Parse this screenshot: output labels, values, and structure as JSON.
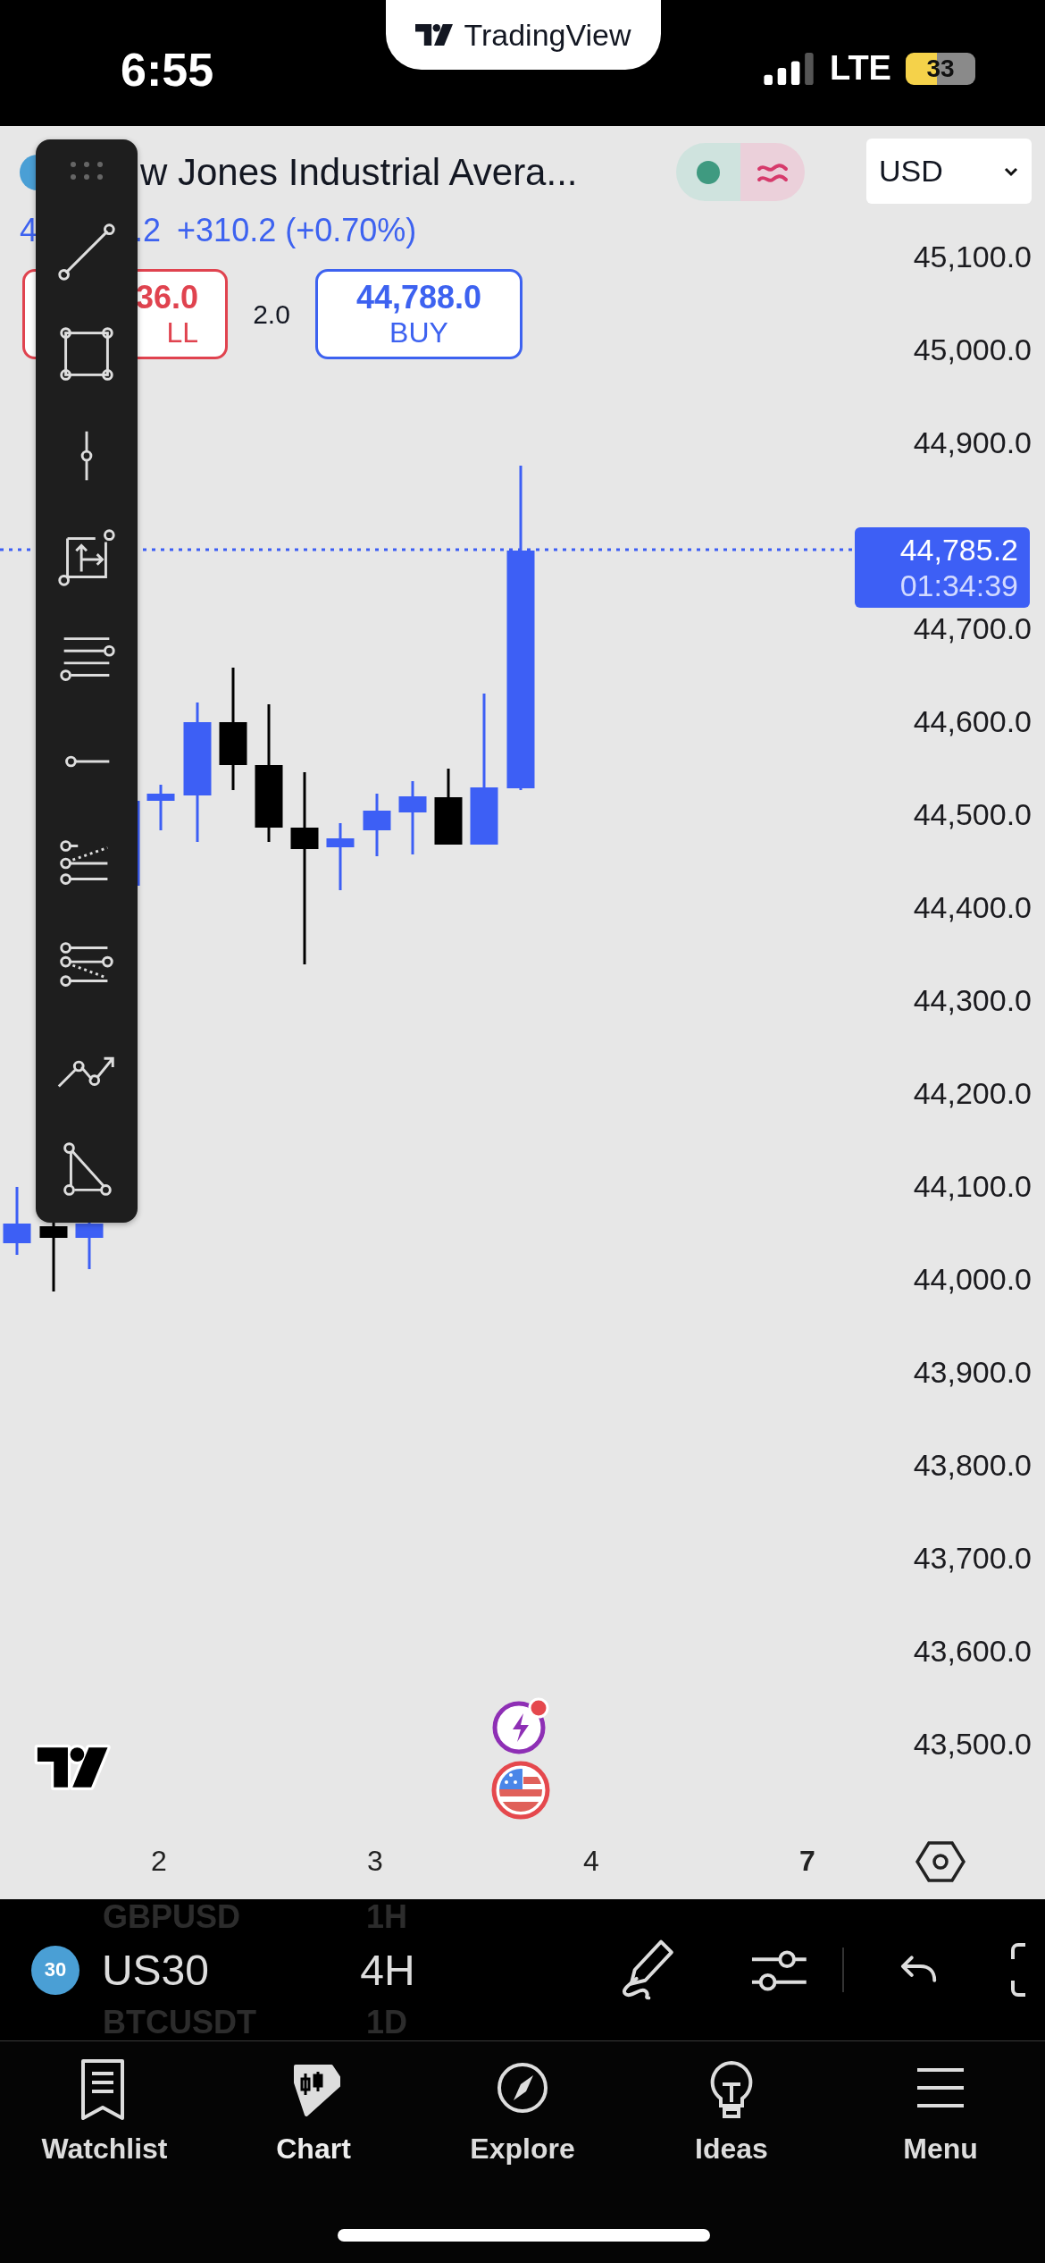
{
  "status_bar": {
    "time": "6:55",
    "banner": "TradingView",
    "network": "LTE",
    "battery": "33"
  },
  "header": {
    "title": "w Jones Industrial Avera...",
    "currency": "USD",
    "price_line": [
      "4",
      ".2",
      "+310.2 (+0.70%)"
    ],
    "trade": {
      "sell_price": "36.0",
      "sell_label": "LL",
      "quantity": "2.0",
      "buy_price": "44,788.0",
      "buy_label": "BUY"
    }
  },
  "drawing_tools": [
    {
      "kind": "trend_line"
    },
    {
      "kind": "rectangle"
    },
    {
      "kind": "vertical_line"
    },
    {
      "kind": "box_arrows"
    },
    {
      "kind": "parallel_lines"
    },
    {
      "kind": "horizontal_ray"
    },
    {
      "kind": "fib_up"
    },
    {
      "kind": "fib_down"
    },
    {
      "kind": "path"
    },
    {
      "kind": "triangle"
    }
  ],
  "price_axis_upper": [
    "45,100.0",
    "45,000.0",
    "44,900.0"
  ],
  "price_axis_lower": [
    "44,700.0",
    "44,600.0",
    "44,500.0",
    "44,400.0",
    "44,300.0",
    "44,200.0",
    "44,100.0",
    "44,000.0",
    "43,900.0",
    "43,800.0",
    "43,700.0",
    "43,600.0",
    "43,500.0"
  ],
  "last_price": {
    "price": "44,785.2",
    "countdown": "01:34:39"
  },
  "time_axis": [
    {
      "label": "2",
      "bold": false
    },
    {
      "label": "3",
      "bold": false
    },
    {
      "label": "4",
      "bold": false
    },
    {
      "label": "7",
      "bold": true
    }
  ],
  "symbol_bar": {
    "prev_symbol": "GBPUSD",
    "prev_interval": "1H",
    "badge": "30",
    "symbol": "US30",
    "interval": "4H",
    "next_symbol": "BTCUSDT",
    "next_interval": "1D"
  },
  "tabs": [
    {
      "label": "Watchlist",
      "kind": "watchlist",
      "selected": false
    },
    {
      "label": "Chart",
      "kind": "chart",
      "selected": true
    },
    {
      "label": "Explore",
      "kind": "explore",
      "selected": false
    },
    {
      "label": "Ideas",
      "kind": "ideas",
      "selected": false
    },
    {
      "label": "Menu",
      "kind": "menu",
      "selected": false
    }
  ]
}
